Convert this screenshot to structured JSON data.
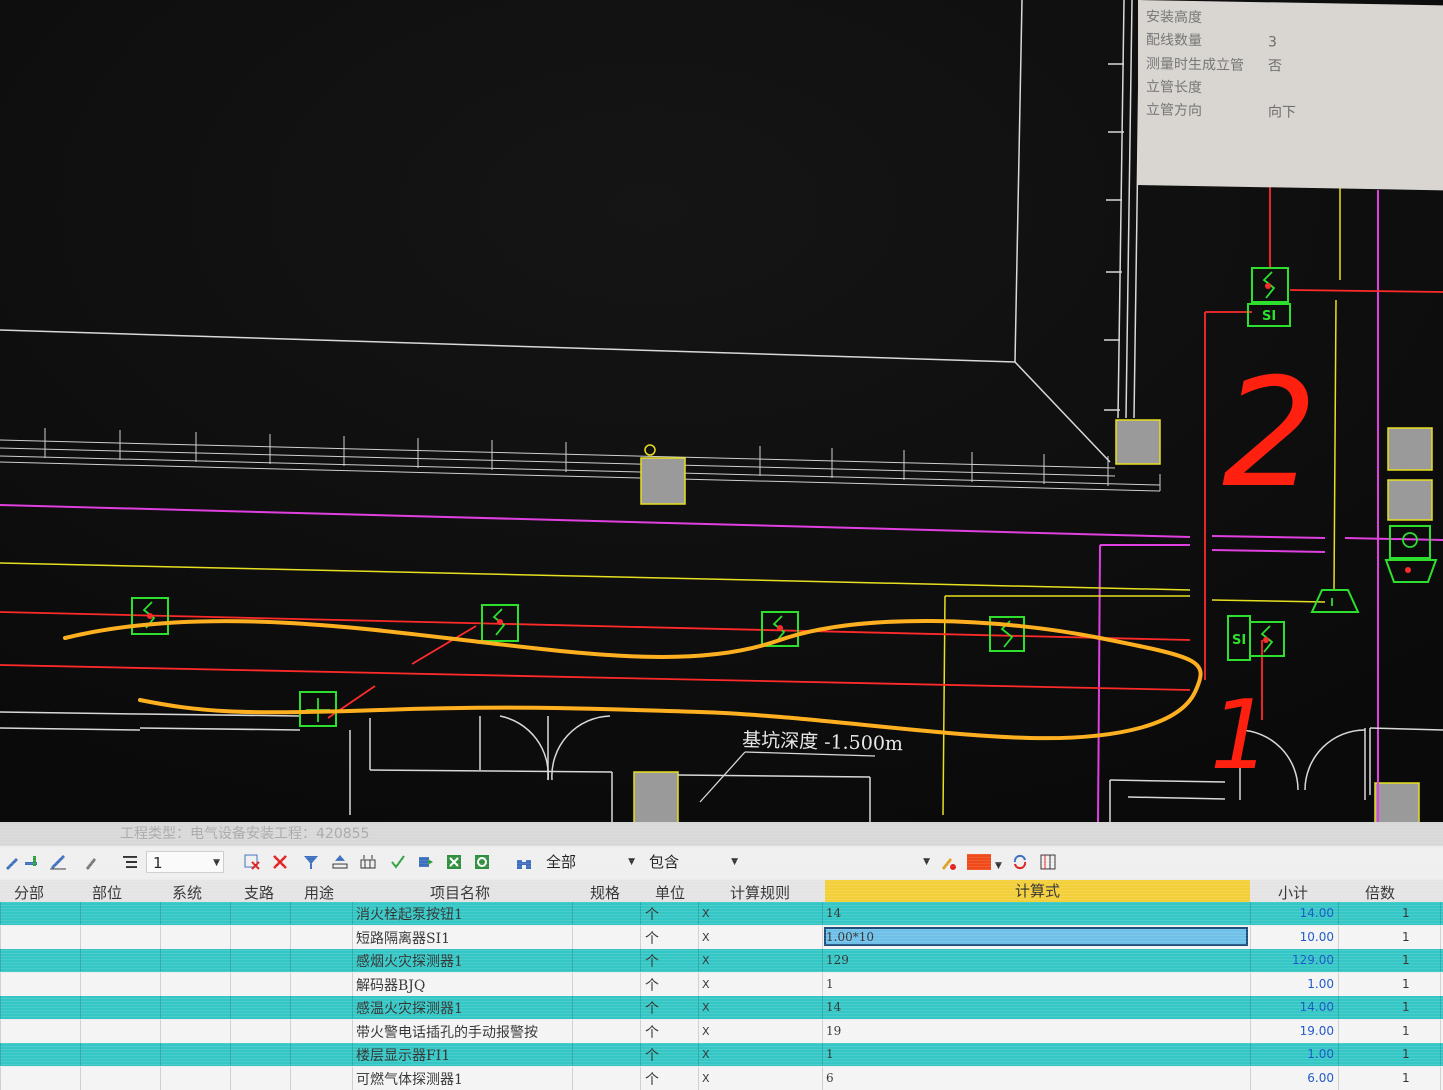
{
  "property_panel": {
    "rows": [
      {
        "label": "安装高度",
        "value": ""
      },
      {
        "label": "配线数量",
        "value": "3"
      },
      {
        "label": "测量时生成立管",
        "value": "否"
      },
      {
        "label": "立管长度",
        "value": ""
      },
      {
        "label": "立管方向",
        "value": "向下"
      }
    ]
  },
  "drawing": {
    "annotation_text": "基坑深度 -1.500m",
    "device_label_si": "SI",
    "handwritten_1": "1",
    "handwritten_2": "2",
    "colors": {
      "background": "#0d0d0d",
      "wall": "#d9d9d9",
      "wire_red": "#ff2a2a",
      "wire_magenta": "#e040e0",
      "wire_yellow": "#e6e020",
      "device_green": "#2ee02e",
      "highlight_orange": "#ffb020",
      "handwriting_red": "#ff2010"
    }
  },
  "panel": {
    "title": "工程类型：电气设备安装工程：420855",
    "toolbar": {
      "level_value": "1",
      "filter_scope": "全部",
      "filter_mode": "包含"
    },
    "columns": [
      "分部",
      "部位",
      "系统",
      "支路",
      "用途",
      "项目名称",
      "规格",
      "单位",
      "计算规则",
      "计算式",
      "小计",
      "倍数"
    ],
    "rows": [
      {
        "name": "消火栓起泵按钮1",
        "unit": "个",
        "rule": "X",
        "formula": "14",
        "subtotal": "14.00",
        "multiplier": "1"
      },
      {
        "name": "短路隔离器SI1",
        "unit": "个",
        "rule": "X",
        "formula": "1.00*10",
        "subtotal": "10.00",
        "multiplier": "1"
      },
      {
        "name": "感烟火灾探测器1",
        "unit": "个",
        "rule": "X",
        "formula": "129",
        "subtotal": "129.00",
        "multiplier": "1"
      },
      {
        "name": "解码器BJQ",
        "unit": "个",
        "rule": "X",
        "formula": "1",
        "subtotal": "1.00",
        "multiplier": "1"
      },
      {
        "name": "感温火灾探测器1",
        "unit": "个",
        "rule": "X",
        "formula": "14",
        "subtotal": "14.00",
        "multiplier": "1"
      },
      {
        "name": "带火警电话插孔的手动报警按",
        "unit": "个",
        "rule": "X",
        "formula": "19",
        "subtotal": "19.00",
        "multiplier": "1"
      },
      {
        "name": "楼层显示器FI1",
        "unit": "个",
        "rule": "X",
        "formula": "1",
        "subtotal": "1.00",
        "multiplier": "1"
      },
      {
        "name": "可燃气体探测器1",
        "unit": "个",
        "rule": "X",
        "formula": "6",
        "subtotal": "6.00",
        "multiplier": "1"
      }
    ]
  }
}
